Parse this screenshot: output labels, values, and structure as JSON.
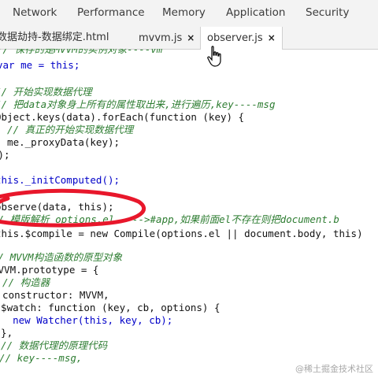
{
  "devtools_tabs": [
    "Network",
    "Performance",
    "Memory",
    "Application",
    "Security"
  ],
  "file_tabs": [
    {
      "label": "数据劫持-数据绑定.html",
      "close": ""
    },
    {
      "label": "mvvm.js",
      "close": "×"
    },
    {
      "label": "observer.js",
      "close": "×"
    }
  ],
  "code_lines": [
    "// 保存的是MVVM的实例对象----vm",
    "var me = this;",
    "",
    "// 开始实现数据代理",
    "// 把data对象身上所有的属性取出来,进行遍历,key----msg",
    "Object.keys(data).forEach(function (key) {",
    "  // 真正的开始实现数据代理",
    "  me._proxyData(key);",
    "});",
    "",
    "this._initComputed();",
    "",
    "observe(data, this);",
    "// 模版解析 options.el ---->#app,如果前面el不存在则把document.b",
    "this.$compile = new Compile(options.el || document.body, this)",
    "",
    "// MVVM构造函数的原型对象",
    "MVVM.prototype = {",
    "  // 构造器",
    "  constructor: MVVM,",
    "  $watch: function (key, cb, options) {",
    "    new Watcher(this, key, cb);",
    "  },",
    "  // 数据代理的原理代码",
    "  // key----msg,"
  ],
  "watermark": "@稀土掘金技术社区",
  "colors": {
    "comment": "#2e7d32",
    "keyword": "#0000c8",
    "annotation": "#e8172b"
  },
  "icons": [
    "pointer-cursor-icon",
    "close-icon"
  ]
}
